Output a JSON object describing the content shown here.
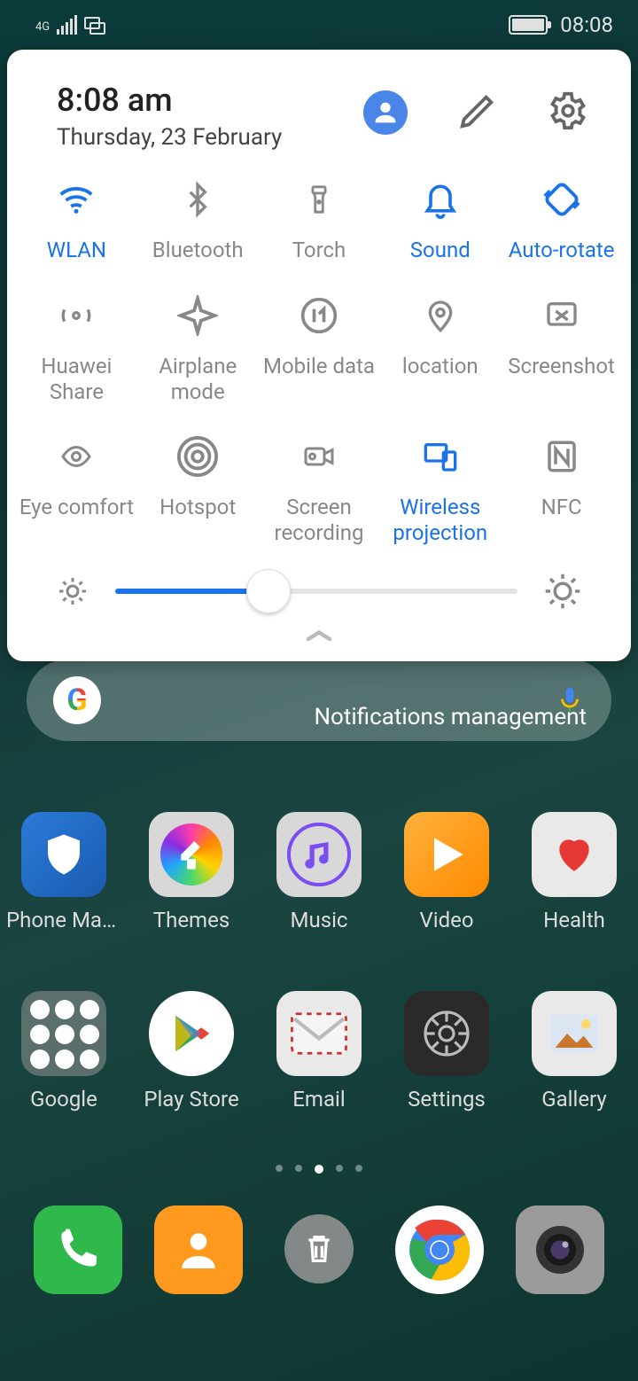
{
  "status": {
    "network": "4G",
    "time": "08:08"
  },
  "panel": {
    "time": "8:08 am",
    "date": "Thursday, 23 February"
  },
  "tiles": [
    {
      "id": "wlan",
      "label": "WLAN",
      "active": true
    },
    {
      "id": "bluetooth",
      "label": "Bluetooth",
      "active": false
    },
    {
      "id": "torch",
      "label": "Torch",
      "active": false
    },
    {
      "id": "sound",
      "label": "Sound",
      "active": true
    },
    {
      "id": "autorotate",
      "label": "Auto-rotate",
      "active": true
    },
    {
      "id": "huaweishare",
      "label": "Huawei Share",
      "active": false
    },
    {
      "id": "airplane",
      "label": "Airplane mode",
      "active": false
    },
    {
      "id": "mobiledata",
      "label": "Mobile data",
      "active": false
    },
    {
      "id": "location",
      "label": "location",
      "active": false
    },
    {
      "id": "screenshot",
      "label": "Screenshot",
      "active": false
    },
    {
      "id": "eyecomfort",
      "label": "Eye comfort",
      "active": false
    },
    {
      "id": "hotspot",
      "label": "Hotspot",
      "active": false
    },
    {
      "id": "screenrec",
      "label": "Screen recording",
      "active": false
    },
    {
      "id": "wireless",
      "label": "Wireless projection",
      "active": true
    },
    {
      "id": "nfc",
      "label": "NFC",
      "active": false
    }
  ],
  "brightness": {
    "percent": 38
  },
  "notif_mgr": "Notifications management",
  "apps_row1": [
    {
      "label": "Phone Man.."
    },
    {
      "label": "Themes"
    },
    {
      "label": "Music"
    },
    {
      "label": "Video"
    },
    {
      "label": "Health"
    }
  ],
  "apps_row2": [
    {
      "label": "Google"
    },
    {
      "label": "Play Store"
    },
    {
      "label": "Email"
    },
    {
      "label": "Settings"
    },
    {
      "label": "Gallery"
    }
  ],
  "dock": [
    {
      "id": "phone"
    },
    {
      "id": "contacts"
    },
    {
      "id": "trash"
    },
    {
      "id": "chrome"
    },
    {
      "id": "camera"
    }
  ]
}
